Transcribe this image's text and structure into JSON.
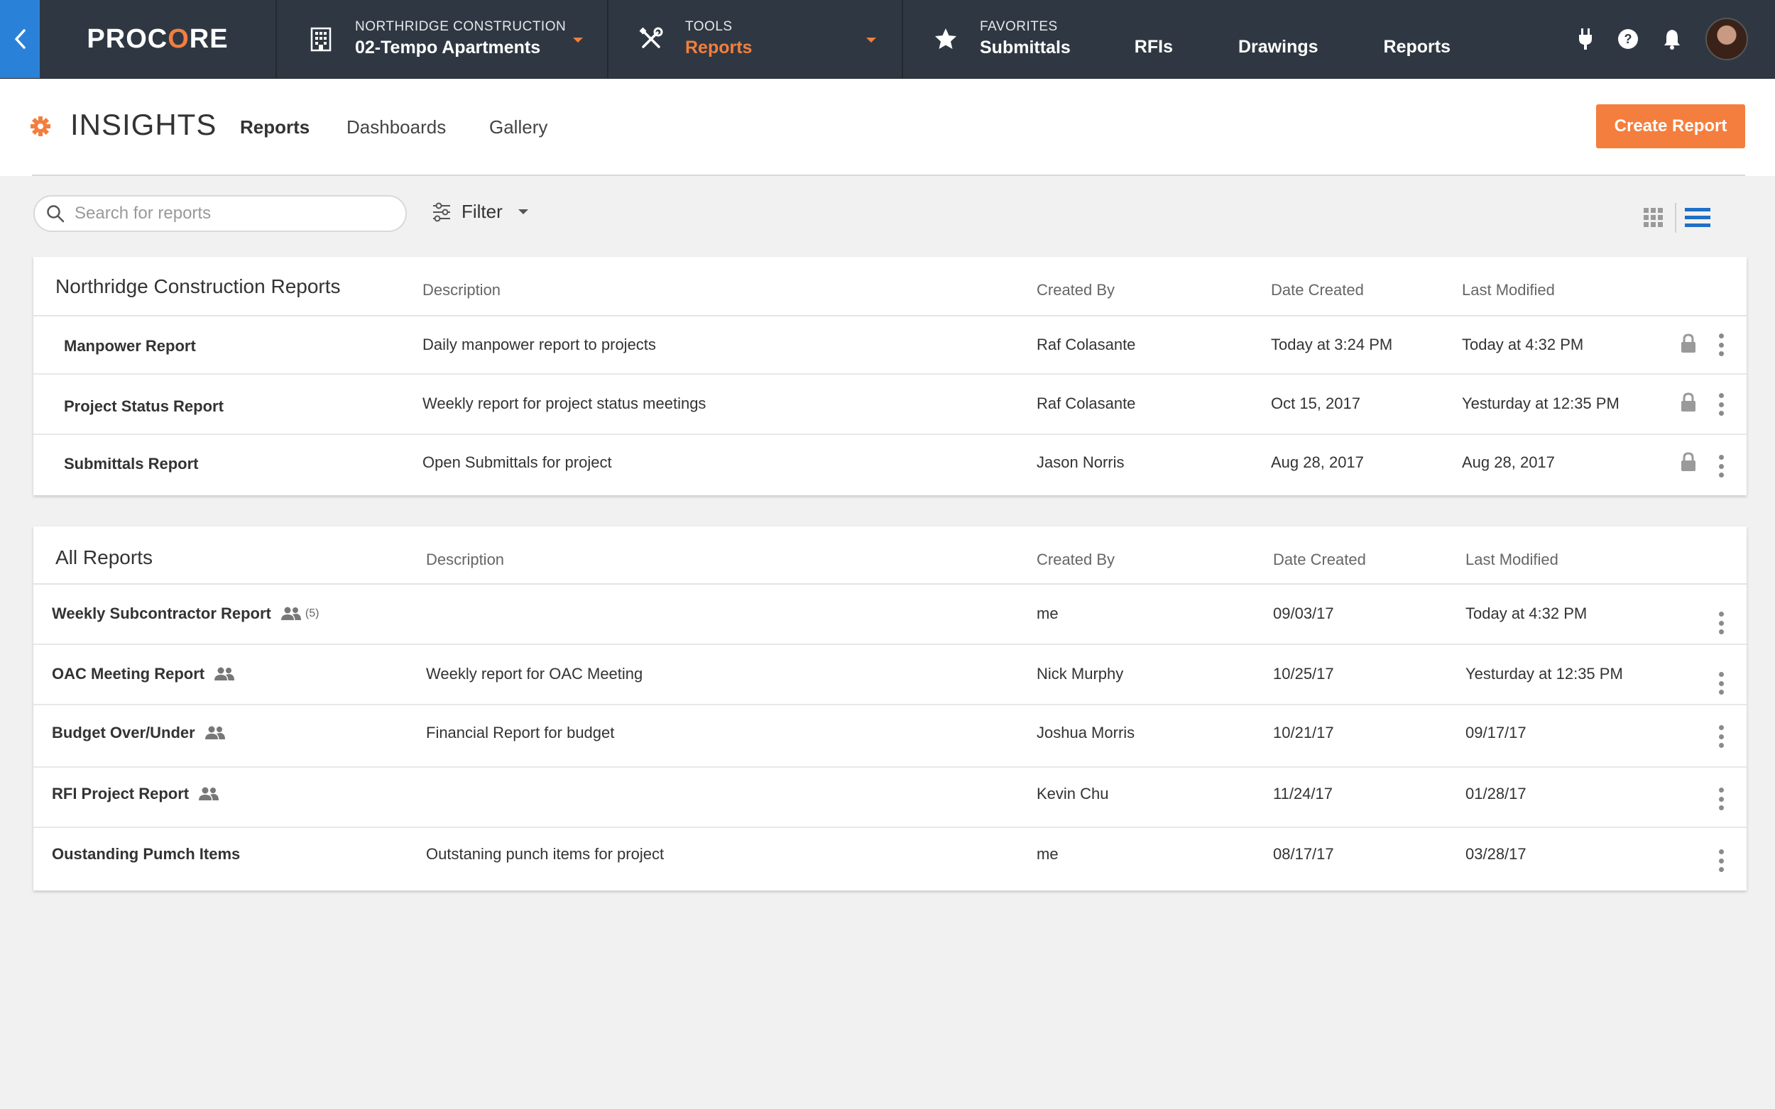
{
  "nav": {
    "logo": "PROCORE",
    "project": {
      "small": "NORTHRIDGE CONSTRUCTION",
      "big": "02-Tempo Apartments"
    },
    "tools": {
      "small": "TOOLS",
      "big": "Reports"
    },
    "favorites": {
      "small": "FAVORITES",
      "links": [
        "Submittals",
        "RFIs",
        "Drawings",
        "Reports"
      ]
    },
    "right_icons": [
      "plug-icon",
      "help-icon",
      "bell-icon"
    ]
  },
  "header": {
    "title": "INSIGHTS",
    "tabs": [
      "Reports",
      "Dashboards",
      "Gallery"
    ],
    "active_tab": "Reports",
    "create_button": "Create Report"
  },
  "toolbar": {
    "search_placeholder": "Search for reports",
    "search_value": "",
    "filter_label": "Filter",
    "active_view": "list"
  },
  "company_reports": {
    "title": "Northridge Construction Reports",
    "columns": [
      "Description",
      "Created By",
      "Date Created",
      "Last Modified"
    ],
    "rows": [
      {
        "name": "Manpower Report",
        "description": "Daily manpower report to projects",
        "created_by": "Raf Colasante",
        "date_created": "Today at 3:24 PM",
        "last_modified": "Today at 4:32 PM",
        "locked": true
      },
      {
        "name": "Project Status Report",
        "description": "Weekly report for project status meetings",
        "created_by": "Raf Colasante",
        "date_created": "Oct 15, 2017",
        "last_modified": "Yesturday at 12:35 PM",
        "locked": true
      },
      {
        "name": "Submittals Report",
        "description": "Open Submittals for project",
        "created_by": "Jason Norris",
        "date_created": "Aug 28, 2017",
        "last_modified": "Aug 28, 2017",
        "locked": true
      }
    ]
  },
  "all_reports": {
    "title": "All Reports",
    "columns": [
      "Description",
      "Created By",
      "Date Created",
      "Last Modified"
    ],
    "rows": [
      {
        "name": "Weekly Subcontractor Report",
        "shared": true,
        "share_count": "(5)",
        "description": "",
        "created_by": "me",
        "date_created": "09/03/17",
        "last_modified": "Today at 4:32 PM"
      },
      {
        "name": "OAC Meeting Report",
        "shared": true,
        "share_count": "",
        "description": "Weekly report for OAC Meeting",
        "created_by": "Nick Murphy",
        "date_created": "10/25/17",
        "last_modified": "Yesturday at 12:35 PM"
      },
      {
        "name": "Budget Over/Under",
        "shared": true,
        "share_count": "",
        "description": "Financial Report for budget",
        "created_by": "Joshua Morris",
        "date_created": "10/21/17",
        "last_modified": "09/17/17"
      },
      {
        "name": "RFI Project Report",
        "shared": true,
        "share_count": "",
        "description": "",
        "created_by": "Kevin Chu",
        "date_created": "11/24/17",
        "last_modified": "01/28/17"
      },
      {
        "name": "Oustanding Pumch Items",
        "shared": false,
        "share_count": "",
        "description": "Outstaning punch items for project",
        "created_by": "me",
        "date_created": "08/17/17",
        "last_modified": "03/28/17"
      }
    ]
  },
  "colors": {
    "accent": "#f47e3e",
    "nav_bg": "#2f3842",
    "back_button": "#2a82d8",
    "view_active": "#1f6fc5"
  }
}
